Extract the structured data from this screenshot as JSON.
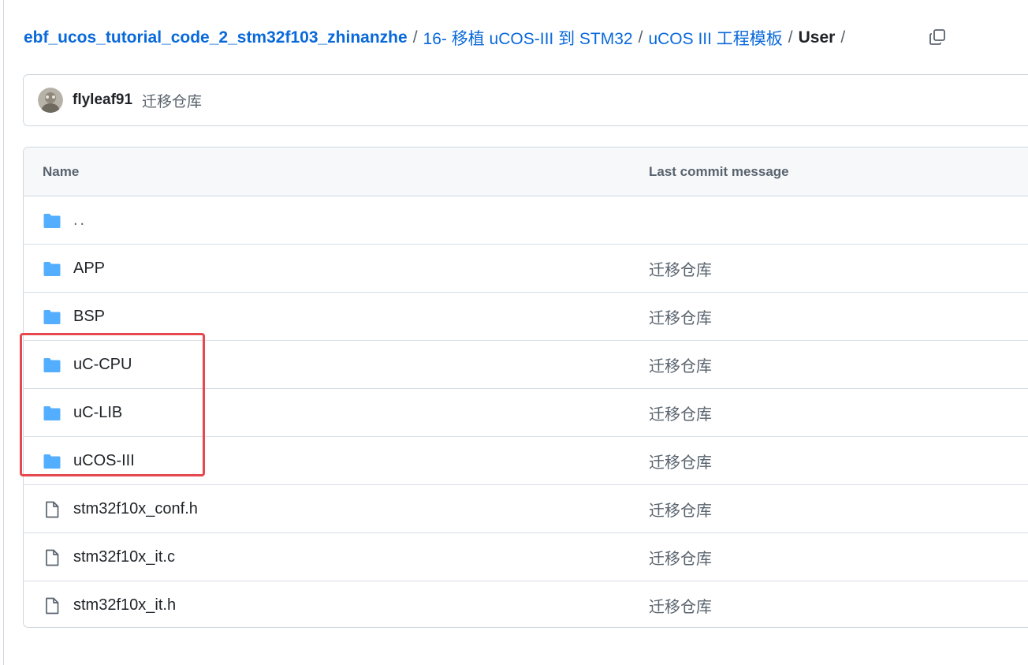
{
  "breadcrumb": {
    "items": [
      {
        "label": "ebf_ucos_tutorial_code_2_stm32f103_zhinanzhe"
      },
      {
        "label": "16- 移植 uCOS-III 到 STM32"
      },
      {
        "label": "uCOS III 工程模板"
      }
    ],
    "current": "User",
    "separator": "/"
  },
  "commit": {
    "author": "flyleaf91",
    "message": "迁移仓库"
  },
  "table": {
    "headers": {
      "name": "Name",
      "commit": "Last commit message"
    },
    "rows": [
      {
        "name": "..",
        "type": "folder",
        "commit": ""
      },
      {
        "name": "APP",
        "type": "folder",
        "commit": "迁移仓库"
      },
      {
        "name": "BSP",
        "type": "folder",
        "commit": "迁移仓库"
      },
      {
        "name": "uC-CPU",
        "type": "folder",
        "commit": "迁移仓库"
      },
      {
        "name": "uC-LIB",
        "type": "folder",
        "commit": "迁移仓库"
      },
      {
        "name": "uCOS-III",
        "type": "folder",
        "commit": "迁移仓库"
      },
      {
        "name": "stm32f10x_conf.h",
        "type": "file",
        "commit": "迁移仓库"
      },
      {
        "name": "stm32f10x_it.c",
        "type": "file",
        "commit": "迁移仓库"
      },
      {
        "name": "stm32f10x_it.h",
        "type": "file",
        "commit": "迁移仓库"
      }
    ]
  },
  "colors": {
    "link": "#0969da",
    "folder": "#54aeff",
    "highlight": "#e5484d",
    "border": "#d0d7de"
  }
}
